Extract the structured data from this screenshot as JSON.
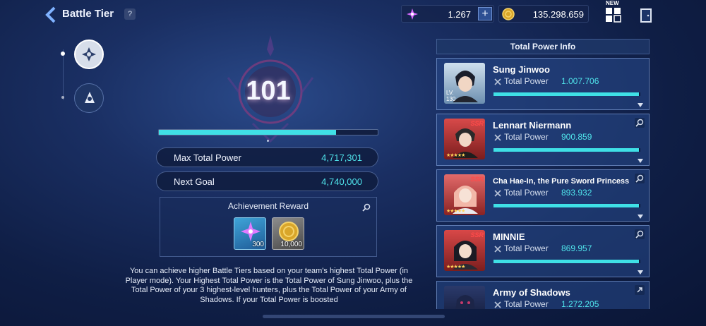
{
  "header": {
    "title": "Battle Tier",
    "help_label": "?",
    "new_badge": "NEW",
    "currency_gem": "1.267",
    "currency_gold": "135.298.659",
    "plus_label": "+"
  },
  "tier": {
    "number": "101",
    "progress_fraction": 0.81
  },
  "stats": {
    "max_total_power_label": "Max Total Power",
    "max_total_power_value": "4,717,301",
    "next_goal_label": "Next Goal",
    "next_goal_value": "4,740,000"
  },
  "reward": {
    "title": "Achievement Reward",
    "items": [
      {
        "icon": "purple-star-crystal-icon",
        "quantity": "300"
      },
      {
        "icon": "gold-coin-icon",
        "quantity": "10,000"
      }
    ]
  },
  "description": "You can achieve higher Battle Tiers based on your team's highest Total Power (in Player mode). Your Highest Total Power is the Total Power of Sung Jinwoo, plus the Total Power of your 3 highest-level hunters, plus the Total Power of your Army of Shadows. If your Total Power is boosted",
  "panel": {
    "title": "Total Power Info",
    "total_power_label": "Total Power",
    "hunters": [
      {
        "name": "Sung Jinwoo",
        "power": "1.007.706",
        "level_label": "LV.",
        "level": "130",
        "bar_fraction": 0.99
      },
      {
        "name": "Lennart Niermann",
        "power": "900.859",
        "rarity": "SSR",
        "stars": "★★★★★",
        "bar_fraction": 0.99
      },
      {
        "name": "Cha Hae-In, the Pure Sword Princess",
        "power": "893.932",
        "rarity": "SSR",
        "stars": "★★★★★",
        "bar_fraction": 0.99
      },
      {
        "name": "MINNIE",
        "power": "869.957",
        "rarity": "SSR",
        "stars": "★★★★★",
        "bar_fraction": 0.99
      },
      {
        "name": "Army of Shadows",
        "power": "1.272.205",
        "bar_fraction": 0.99
      }
    ]
  },
  "colors": {
    "accent_cyan": "#4fe3ea",
    "background": "#1a2f63",
    "ssr_red": "#ff4a4a"
  }
}
